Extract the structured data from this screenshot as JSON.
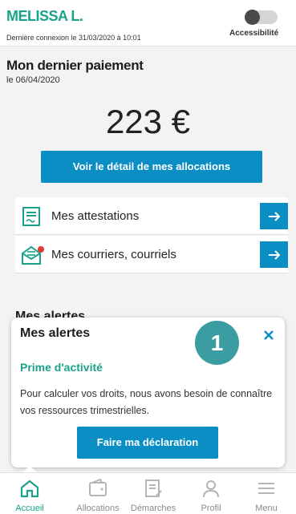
{
  "header": {
    "user_name": "MELISSA L.",
    "last_login": "Dernière connexion le 31/03/2020 à 10:01",
    "accessibility_label": "Accessibilité"
  },
  "payment": {
    "title": "Mon dernier paiement",
    "date": "le 06/04/2020",
    "amount": "223 €",
    "detail_button": "Voir le détail de mes allocations"
  },
  "links": [
    {
      "label": "Mes attestations",
      "icon": "document-icon"
    },
    {
      "label": "Mes courriers, courriels",
      "icon": "envelope-icon"
    }
  ],
  "alerts": {
    "heading": "Mes alertes"
  },
  "overlay": {
    "title": "Mes alertes",
    "step": "1",
    "subtitle": "Prime d'activité",
    "text": "Pour calculer vos droits, nous avons besoin de connaître vos ressources trimestrielles.",
    "button": "Faire ma déclaration"
  },
  "nav": [
    {
      "label": "Accueil",
      "icon": "home-icon",
      "active": true
    },
    {
      "label": "Allocations",
      "icon": "wallet-icon",
      "active": false
    },
    {
      "label": "Démarches",
      "icon": "form-icon",
      "active": false
    },
    {
      "label": "Profil",
      "icon": "user-icon",
      "active": false
    },
    {
      "label": "Menu",
      "icon": "menu-icon",
      "active": false
    }
  ],
  "colors": {
    "brand_green": "#19a38a",
    "action_blue": "#0a8ec4",
    "step_teal": "#3b9ca1",
    "notification_red": "#e53935"
  }
}
